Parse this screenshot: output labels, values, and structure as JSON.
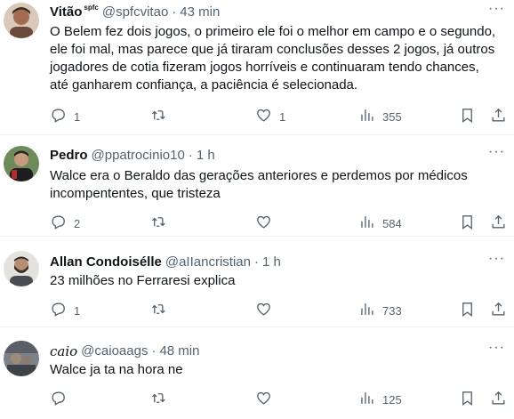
{
  "tweets": [
    {
      "name": "Vitão",
      "flair": "spfc",
      "handle": "@spfcvitao",
      "dot": "·",
      "time": "43 min",
      "text": "O Belem fez dois jogos, o primeiro ele foi o melhor em campo e o segundo, ele foi mal, mas parece que já tiraram conclusões desses 2 jogos, já outros jogadores de cotia fizeram jogos horríveis e continuaram tendo chances, até ganharem confiança, a paciência é selecionada.",
      "replies": "1",
      "retweets": "",
      "likes": "1",
      "views": "355",
      "avatar_color": "#6b4a3a"
    },
    {
      "name": "Pedro",
      "flair": "",
      "handle": "@ppatrocinio10",
      "dot": "·",
      "time": "1 h",
      "text": "Walce era o Beraldo das gerações anteriores e perdemos por médicos incompententes, que tristeza",
      "replies": "2",
      "retweets": "",
      "likes": "",
      "views": "584",
      "avatar_color": "#3b5b34"
    },
    {
      "name": "Allan Condoisélle",
      "flair": "",
      "handle": "@aIIancristian",
      "dot": "·",
      "time": "1 h",
      "text": "23 milhões no Ferraresi explica",
      "replies": "1",
      "retweets": "",
      "likes": "",
      "views": "733",
      "avatar_color": "#8a7a6e"
    },
    {
      "name": "caio",
      "flair": "",
      "handle": "@caioaags",
      "dot": "·",
      "time": "48 min",
      "text": "Walce ja ta na hora ne",
      "replies": "",
      "retweets": "",
      "likes": "",
      "views": "125",
      "avatar_color": "#5a5e66"
    }
  ],
  "icons": {
    "more": "more-icon",
    "reply": "reply-icon",
    "retweet": "retweet-icon",
    "like": "like-icon",
    "views": "views-icon",
    "bookmark": "bookmark-icon",
    "share": "share-icon"
  },
  "colors": {
    "text": "#0f1419",
    "secondary": "#536471",
    "border": "#eff3f4"
  }
}
